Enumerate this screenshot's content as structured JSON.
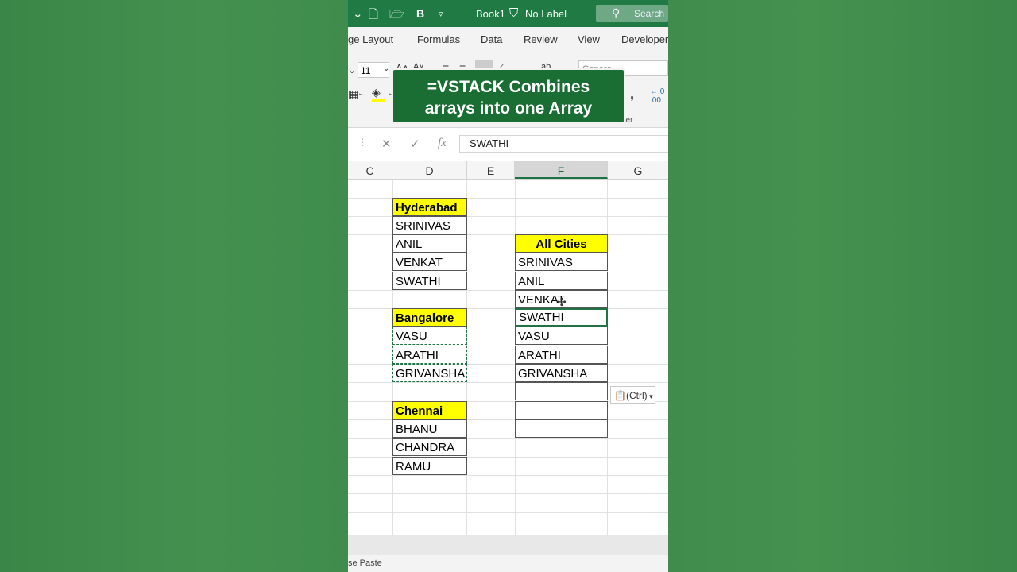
{
  "titlebar": {
    "book_name": "Book1",
    "label": "No Label",
    "search_text": "Search",
    "bg_color": "#1f7a43"
  },
  "tabs": [
    "ge Layout",
    "Formulas",
    "Data",
    "Review",
    "View",
    "Developer"
  ],
  "ribbon": {
    "font_size": "11",
    "group_fragment": "ber",
    "number_format_fragment": "Genera"
  },
  "overlay": {
    "line1": "=VSTACK Combines",
    "line2": "arrays into one Array"
  },
  "formula_bar": {
    "value": "SWATHI"
  },
  "columns": [
    "C",
    "D",
    "E",
    "F",
    "G"
  ],
  "selected_column": "F",
  "sheet": {
    "hyderabad_header": "Hyderabad",
    "hyderabad": [
      "SRINIVAS",
      "ANIL",
      "VENKAT",
      "SWATHI"
    ],
    "bangalore_header": "Bangalore",
    "bangalore": [
      "VASU",
      "ARATHI",
      "GRIVANSHA"
    ],
    "chennai_header": "Chennai",
    "chennai": [
      "BHANU",
      "CHANDRA",
      "RAMU"
    ],
    "all_header": "All Cities",
    "all": [
      "SRINIVAS",
      "ANIL",
      "VENKAT",
      "SWATHI",
      "VASU",
      "ARATHI",
      "GRIVANSHA",
      "",
      "",
      ""
    ]
  },
  "paste_options": "(Ctrl)",
  "status": "se Paste",
  "colors": {
    "header_fill": "#ffff00",
    "excel_green": "#217346",
    "overlay_bg": "#1a6e34"
  }
}
